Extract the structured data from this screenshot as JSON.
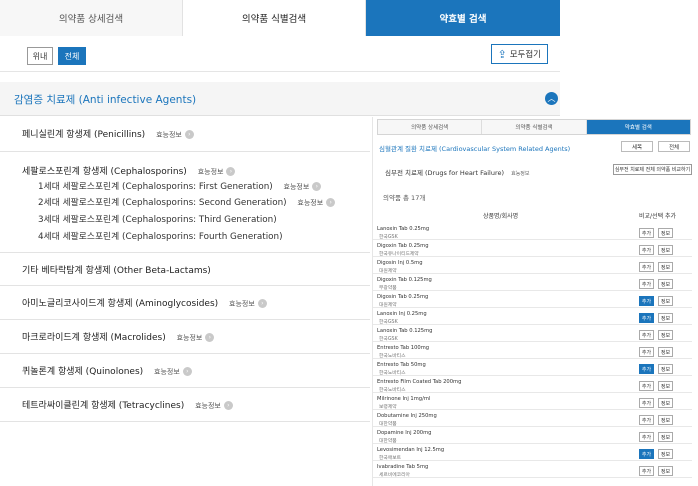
{
  "tabs": [
    {
      "label": "의약품 상세검색"
    },
    {
      "label": "의약품 식별검색"
    },
    {
      "label": "약효별 검색"
    }
  ],
  "toolbar": {
    "btn_domestic": "위내",
    "btn_all": "전체",
    "collapse_label": "모두접기"
  },
  "category": {
    "title": "감염증 치료제 (Anti infective Agents)"
  },
  "info_label": "효능정보",
  "list": {
    "items": [
      {
        "label": "페니실린계 항생제 (Penicillins)"
      },
      {
        "label": "세팔로스포린계 항생제 (Cephalosporins)"
      },
      {
        "label": "기타 베타락탐계 항생제 (Other Beta-Lactams)"
      },
      {
        "label": "아미노글리코사이드계 항생제 (Aminoglycosides)"
      },
      {
        "label": "마크로라이드계 항생제 (Macrolides)"
      },
      {
        "label": "퀴놀론계 항생제 (Quinolones)"
      },
      {
        "label": "테트라싸이클린계 항생제 (Tetracyclines)"
      }
    ],
    "subs": [
      {
        "label": "1세대 세팔로스포린계 (Cephalosporins: First Generation)"
      },
      {
        "label": "2세대 세팔로스포린계 (Cephalosporins: Second Generation)"
      },
      {
        "label": "3세대 세팔로스포린계 (Cephalosporins: Third Generation)"
      },
      {
        "label": "4세대 세팔로스포린계 (Cephalosporins: Fourth Generation)"
      }
    ]
  },
  "panel": {
    "tabs": [
      {
        "label": "의약품 상세검색"
      },
      {
        "label": "의약품 식별검색"
      },
      {
        "label": "약효별 검색"
      }
    ],
    "crumb": "심혈관계 질환 치료제 (Cardiovascular System Related Agents)",
    "btn_a": "세목",
    "btn_b": "전체",
    "sub_title": "심부전 치료제 (Drugs for Heart Failure)",
    "sub_info": "효능정보",
    "big_btn": "심부전 치료제 전체 의약품 비교하기",
    "count": "의약품 총 17개",
    "col_name": "상품명/회사명",
    "col_action": "비교/선택 추가",
    "action_a": "추가",
    "action_b": "정보",
    "rows": [
      {
        "name": "Lanoxin Tab 0.25mg",
        "company": "한국GSK",
        "on": false
      },
      {
        "name": "Digoxin Tab 0.25mg",
        "company": "한국유나이티드제약",
        "on": false
      },
      {
        "name": "Digosin Inj 0.5mg",
        "company": "대원제약",
        "on": false
      },
      {
        "name": "Digoxin Tab 0.125mg",
        "company": "부광약품",
        "on": false
      },
      {
        "name": "Digosin Tab 0.25mg",
        "company": "대원제약",
        "on": true
      },
      {
        "name": "Lanoxin Inj 0.25mg",
        "company": "한국GSK",
        "on": true
      },
      {
        "name": "Lanoxin Tab 0.125mg",
        "company": "한국GSK",
        "on": false
      },
      {
        "name": "Entresto Tab 100mg",
        "company": "한국노바티스",
        "on": false
      },
      {
        "name": "Entresto Tab 50mg",
        "company": "한국노바티스",
        "on": true
      },
      {
        "name": "Entresto Film Coated Tab 200mg",
        "company": "한국노바티스",
        "on": false
      },
      {
        "name": "Milrinone Inj 1mg/ml",
        "company": "보령제약",
        "on": false
      },
      {
        "name": "Dobutamine Inj 250mg",
        "company": "대한약품",
        "on": false
      },
      {
        "name": "Dopamine Inj 200mg",
        "company": "대한약품",
        "on": false
      },
      {
        "name": "Levosimendan Inj 12.5mg",
        "company": "한국애보트",
        "on": true
      },
      {
        "name": "Ivabradine Tab 5mg",
        "company": "세르비에코리아",
        "on": false
      }
    ]
  }
}
